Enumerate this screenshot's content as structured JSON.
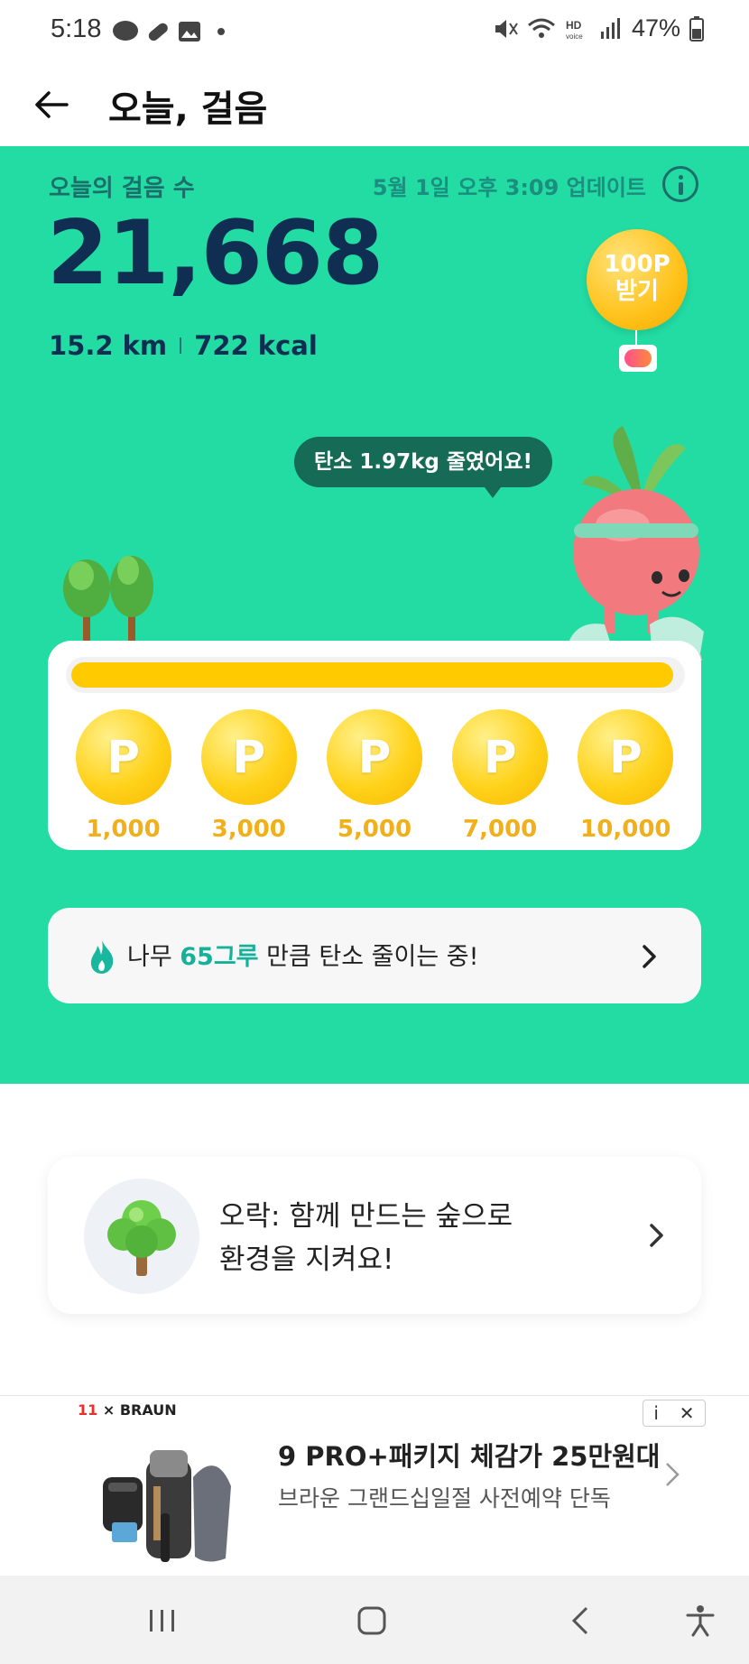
{
  "status_bar": {
    "time": "5:18",
    "battery": "47%"
  },
  "header": {
    "title": "오늘, 걸음"
  },
  "hero": {
    "steps_label": "오늘의 걸음 수",
    "updated": "5월 1일 오후 3:09 업데이트",
    "steps": "21,668",
    "distance": "15.2 km",
    "calories": "722 kcal",
    "reward_line1": "100P",
    "reward_line2": "받기",
    "carbon_bubble": "탄소 1.97kg 줄였어요!",
    "progress_fraction": 0.99,
    "milestones": [
      {
        "icon": "P",
        "label": "1,000"
      },
      {
        "icon": "P",
        "label": "3,000"
      },
      {
        "icon": "P",
        "label": "5,000"
      },
      {
        "icon": "P",
        "label": "7,000"
      },
      {
        "icon": "P",
        "label": "10,000"
      }
    ],
    "tree_text_prefix": "나무 ",
    "tree_text_highlight": "65그루",
    "tree_text_suffix": " 만큼 탄소 줄이는 중!"
  },
  "forest_card": {
    "line1": "오락: 함께 만드는 숲으로",
    "line2": "환경을 지켜요!"
  },
  "ad": {
    "brand_left": "11",
    "brand_right": "× BRAUN",
    "title": "9 PRO+패키지 체감가 25만원대",
    "subtitle": "브라운 그랜드십일절 사전예약 단독",
    "info": "i",
    "close": "✕"
  },
  "colors": {
    "hero_bg": "#22DCA3",
    "steps_text": "#0f2e52",
    "progress_fill": "#FFCB00",
    "highlight": "#17b199"
  }
}
